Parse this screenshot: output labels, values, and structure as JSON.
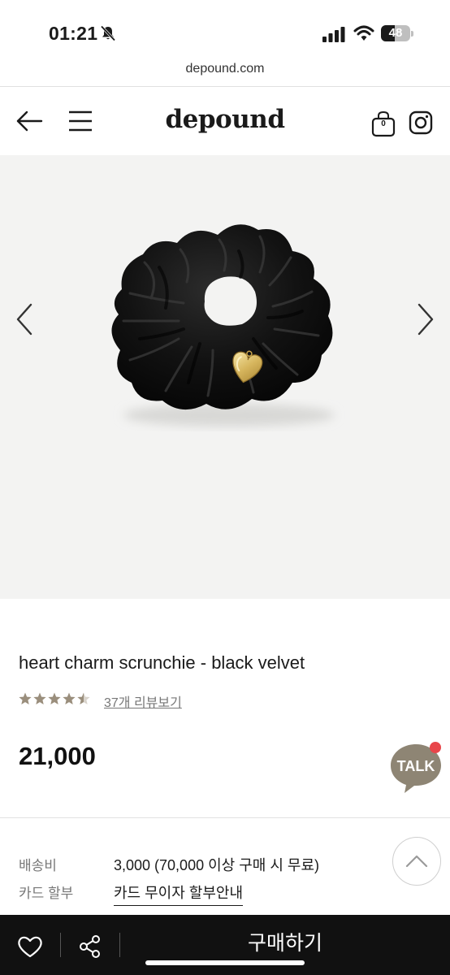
{
  "status_bar": {
    "time": "01:21",
    "battery_level": "48",
    "battery_fraction": 0.48,
    "icons": [
      "bell-slash-icon",
      "cellular-signal-icon",
      "wifi-icon",
      "battery-icon"
    ]
  },
  "browser": {
    "url": "depound.com"
  },
  "header": {
    "logo": "depound",
    "cart_count": "0",
    "icons": [
      "arrow-left-icon",
      "hamburger-menu-icon",
      "shopping-bag-icon",
      "instagram-icon"
    ]
  },
  "gallery": {
    "image_subject": "black velvet scrunchie with gold heart charm",
    "icons": [
      "chevron-left-icon",
      "chevron-right-icon"
    ]
  },
  "product": {
    "name": "heart charm scrunchie - black velvet",
    "rating": 4.5,
    "rating_max": 5,
    "review_link": "37개 리뷰보기",
    "price": "21,000"
  },
  "talk_button": {
    "label": "TALK",
    "color": "#8e8574",
    "badge_color": "#e8464a"
  },
  "details": {
    "shipping_label": "배송비",
    "shipping_value": "3,000 (70,000 이상 구매 시 무료)",
    "card_label": "카드 할부",
    "card_value": "카드 무이자 할부안내"
  },
  "bottom_bar": {
    "buy_label": "구매하기",
    "icons": [
      "heart-icon",
      "share-icon"
    ]
  },
  "colors": {
    "star": "#9a8e7c",
    "bottom_bar": "#111111",
    "gallery_bg": "#f3f3f2"
  }
}
